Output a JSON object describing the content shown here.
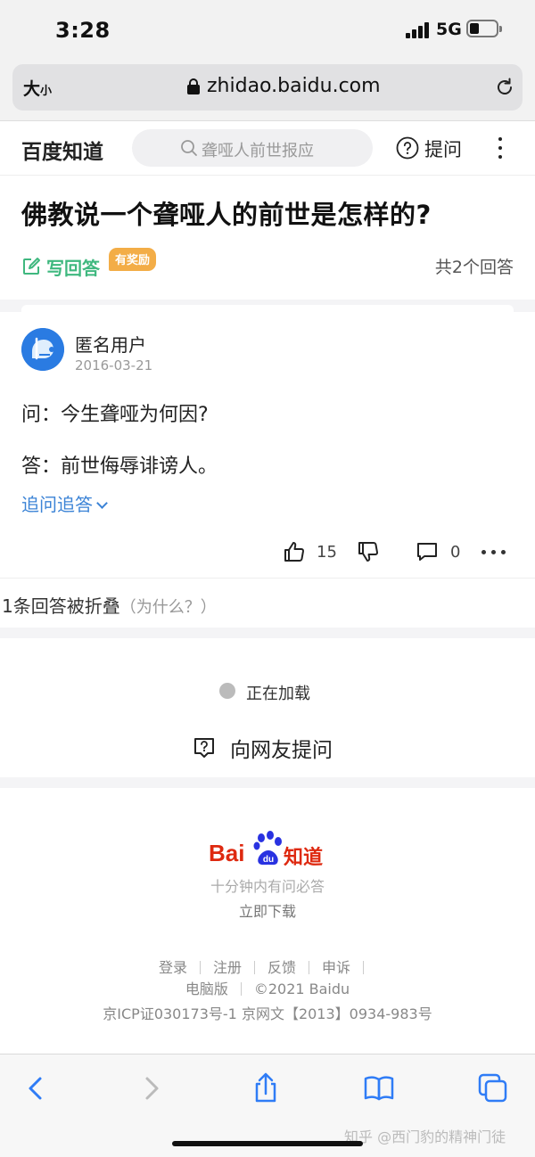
{
  "status_bar": {
    "time": "3:28",
    "network": "5G"
  },
  "address_bar": {
    "text_size_label_big": "大",
    "text_size_label_small": "小",
    "url": "zhidao.baidu.com"
  },
  "site_header": {
    "brand": "百度知道",
    "search_placeholder": "聋哑人前世报应",
    "ask_label": "提问"
  },
  "question": {
    "title": "佛教说一个聋哑人的前世是怎样的?",
    "write_answer_label": "写回答",
    "reward_badge": "有奖励",
    "answer_count": "共2个回答"
  },
  "answer": {
    "user_name": "匿名用户",
    "date": "2016-03-21",
    "paragraphs": [
      "问：今生聋哑为何因?",
      "答：前世侮辱诽谤人。"
    ],
    "follow_up_label": "追问追答",
    "likes": "15",
    "comments": "0"
  },
  "folded": {
    "text": "1条回答被折叠",
    "why": "（为什么？）"
  },
  "loading_label": "正在加载",
  "ask_friends_label": "向网友提问",
  "footer": {
    "logo_text": "Bai",
    "logo_paw_text": "du",
    "logo_suffix": "知道",
    "slogan": "十分钟内有问必答",
    "download": "立即下载",
    "links": [
      "登录",
      "注册",
      "反馈",
      "申诉"
    ],
    "desktop": "电脑版",
    "copyright": "©2021 Baidu",
    "icp": "京ICP证030173号-1   京网文【2013】0934-983号"
  },
  "watermark": "知乎 @西门豹的精神门徒",
  "colors": {
    "accent_green": "#3fb87f",
    "link_blue": "#3b83d6",
    "reward_orange": "#f3ad47",
    "brand_red": "#de2910"
  },
  "icons": [
    "lock-icon",
    "reload-icon",
    "search-icon",
    "question-icon",
    "more-icon",
    "edit-icon",
    "thumbs-up-icon",
    "thumbs-down-icon",
    "comment-icon",
    "back-icon",
    "forward-icon",
    "share-icon",
    "bookmarks-icon",
    "tabs-icon"
  ]
}
